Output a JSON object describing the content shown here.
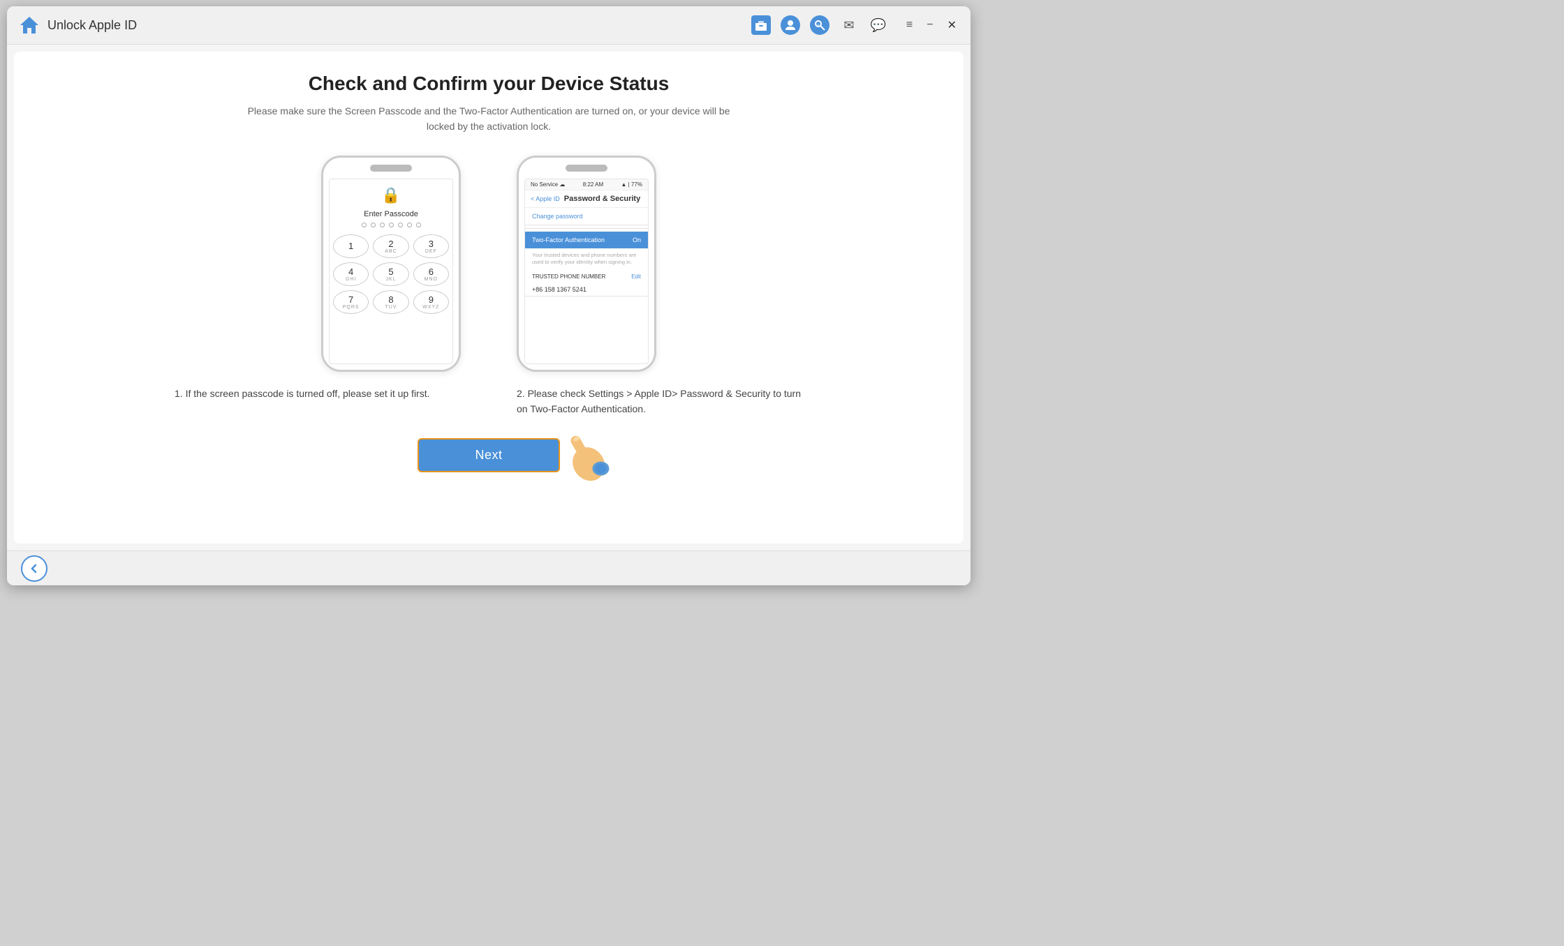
{
  "titlebar": {
    "title": "Unlock Apple ID",
    "home_icon": "🏠",
    "icons": [
      {
        "name": "toolbox-icon",
        "symbol": "🗂",
        "style": "blue-bg"
      },
      {
        "name": "user-icon",
        "symbol": "👤",
        "style": "circle"
      },
      {
        "name": "music-search-icon",
        "symbol": "🎵",
        "style": "circle"
      }
    ],
    "window_icons": [
      {
        "name": "mail-icon",
        "symbol": "✉"
      },
      {
        "name": "chat-icon",
        "symbol": "💬"
      },
      {
        "name": "menu-icon",
        "symbol": "≡"
      },
      {
        "name": "minimize-icon",
        "symbol": "−"
      },
      {
        "name": "close-icon",
        "symbol": "×"
      }
    ]
  },
  "page": {
    "title": "Check and Confirm your Device Status",
    "subtitle": "Please make sure the Screen Passcode and the Two-Factor Authentication are turned on, or your device will be locked by the activation lock.",
    "phone1": {
      "enter_passcode": "Enter Passcode",
      "dot_count": 7,
      "keys": [
        {
          "num": "1",
          "sub": ""
        },
        {
          "num": "2",
          "sub": "ABC"
        },
        {
          "num": "3",
          "sub": "DEF"
        },
        {
          "num": "4",
          "sub": "GHI"
        },
        {
          "num": "5",
          "sub": "JKL"
        },
        {
          "num": "6",
          "sub": "MNO"
        },
        {
          "num": "7",
          "sub": "PQRS"
        },
        {
          "num": "8",
          "sub": "TUV"
        },
        {
          "num": "9",
          "sub": "WXYZ"
        }
      ]
    },
    "phone2": {
      "status_left": "No Service ☁",
      "status_center": "8:22 AM",
      "status_right": "▲ | 77%",
      "back_link": "< Apple ID",
      "screen_title": "Password & Security",
      "change_password": "Change password",
      "two_factor_label": "Two-Factor Authentication",
      "two_factor_value": "On",
      "note": "Your trusted devices and phone numbers are used to verify your identity when signing in.",
      "trusted_phone_label": "TRUSTED PHONE NUMBER",
      "trusted_phone_edit": "Edit",
      "phone_number": "+86 158 1367 5241"
    },
    "desc1": "1. If the screen passcode is turned off, please set it up first.",
    "desc2": "2. Please check Settings > Apple ID> Password & Security to turn on Two-Factor Authentication.",
    "next_button": "Next",
    "back_button": "←"
  }
}
